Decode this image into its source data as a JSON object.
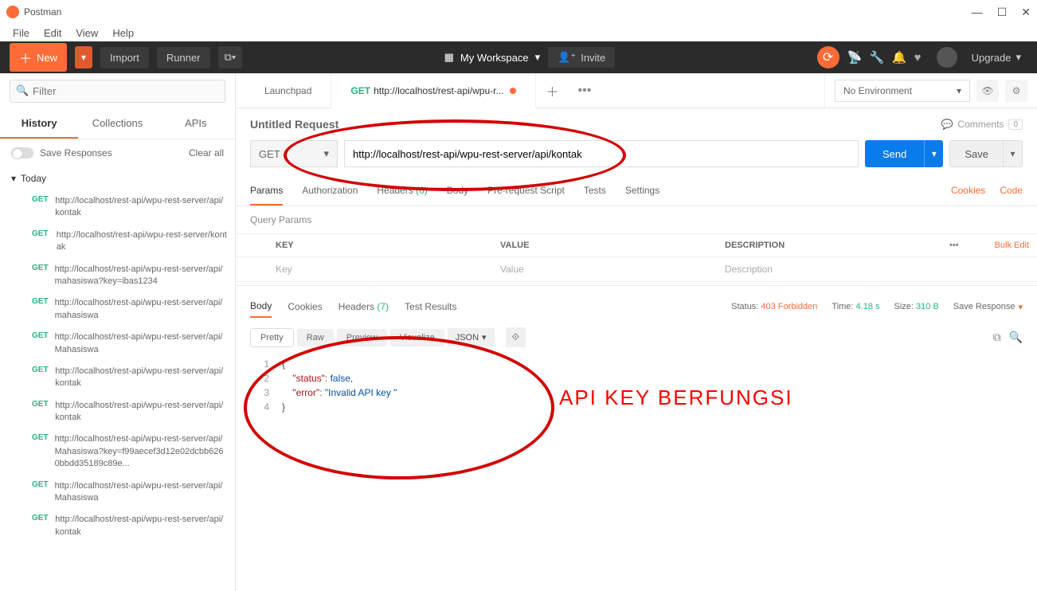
{
  "app": {
    "title": "Postman"
  },
  "menu": [
    "File",
    "Edit",
    "View",
    "Help"
  ],
  "toolbar": {
    "new": "New",
    "import": "Import",
    "runner": "Runner",
    "workspace": "My Workspace",
    "invite": "Invite",
    "upgrade": "Upgrade"
  },
  "sidebar": {
    "filter_placeholder": "Filter",
    "tabs": {
      "history": "History",
      "collections": "Collections",
      "apis": "APIs"
    },
    "save_responses": "Save Responses",
    "clear_all": "Clear all",
    "today": "Today",
    "items": [
      {
        "method": "GET",
        "url": "http://localhost/rest-api/wpu-rest-server/api/kontak"
      },
      {
        "method": "GET",
        "url": "http://localhost/rest-api/wpu-rest-server/kontak"
      },
      {
        "method": "GET",
        "url": "http://localhost/rest-api/wpu-rest-server/api/mahasiswa?key=ibas1234"
      },
      {
        "method": "GET",
        "url": "http://localhost/rest-api/wpu-rest-server/api/mahasiswa"
      },
      {
        "method": "GET",
        "url": "http://localhost/rest-api/wpu-rest-server/api/Mahasiswa"
      },
      {
        "method": "GET",
        "url": "http://localhost/rest-api/wpu-rest-server/api/kontak"
      },
      {
        "method": "GET",
        "url": "http://localhost/rest-api/wpu-rest-server/api/kontak"
      },
      {
        "method": "GET",
        "url": "http://localhost/rest-api/wpu-rest-server/api/Mahasiswa?key=f99aecef3d12e02dcbb6260bbdd35189c89e..."
      },
      {
        "method": "GET",
        "url": "http://localhost/rest-api/wpu-rest-server/api/Mahasiswa"
      },
      {
        "method": "GET",
        "url": "http://localhost/rest-api/wpu-rest-server/api/kontak"
      }
    ]
  },
  "tabs": {
    "launchpad": "Launchpad",
    "active": {
      "method": "GET",
      "label": "http://localhost/rest-api/wpu-r..."
    }
  },
  "env": {
    "none": "No Environment"
  },
  "request": {
    "title": "Untitled Request",
    "comments": "Comments",
    "comment_count": "0",
    "method": "GET",
    "url": "http://localhost/rest-api/wpu-rest-server/api/kontak",
    "send": "Send",
    "save": "Save",
    "tabs": {
      "params": "Params",
      "auth": "Authorization",
      "headers": "Headers",
      "headers_count": "(6)",
      "body": "Body",
      "prerequest": "Pre-request Script",
      "tests": "Tests",
      "settings": "Settings"
    },
    "cookies": "Cookies",
    "code": "Code",
    "query_params": "Query Params",
    "th": {
      "key": "KEY",
      "value": "VALUE",
      "desc": "DESCRIPTION",
      "bulk": "Bulk Edit"
    },
    "placeholder": {
      "key": "Key",
      "value": "Value",
      "desc": "Description"
    }
  },
  "response": {
    "tabs": {
      "body": "Body",
      "cookies": "Cookies",
      "headers": "Headers",
      "headers_count": "(7)",
      "test_results": "Test Results"
    },
    "status_lbl": "Status:",
    "status": "403 Forbidden",
    "time_lbl": "Time:",
    "time": "4.18 s",
    "size_lbl": "Size:",
    "size": "310 B",
    "save": "Save Response",
    "view": {
      "pretty": "Pretty",
      "raw": "Raw",
      "preview": "Preview",
      "visualize": "Visualize",
      "json": "JSON"
    },
    "body_lines": [
      {
        "n": "1",
        "t": "{"
      },
      {
        "n": "2",
        "t": "    \"status\": false,"
      },
      {
        "n": "3",
        "t": "    \"error\": \"Invalid API key \""
      },
      {
        "n": "4",
        "t": "}"
      }
    ]
  },
  "annotation": "API KEY BERFUNGSI"
}
